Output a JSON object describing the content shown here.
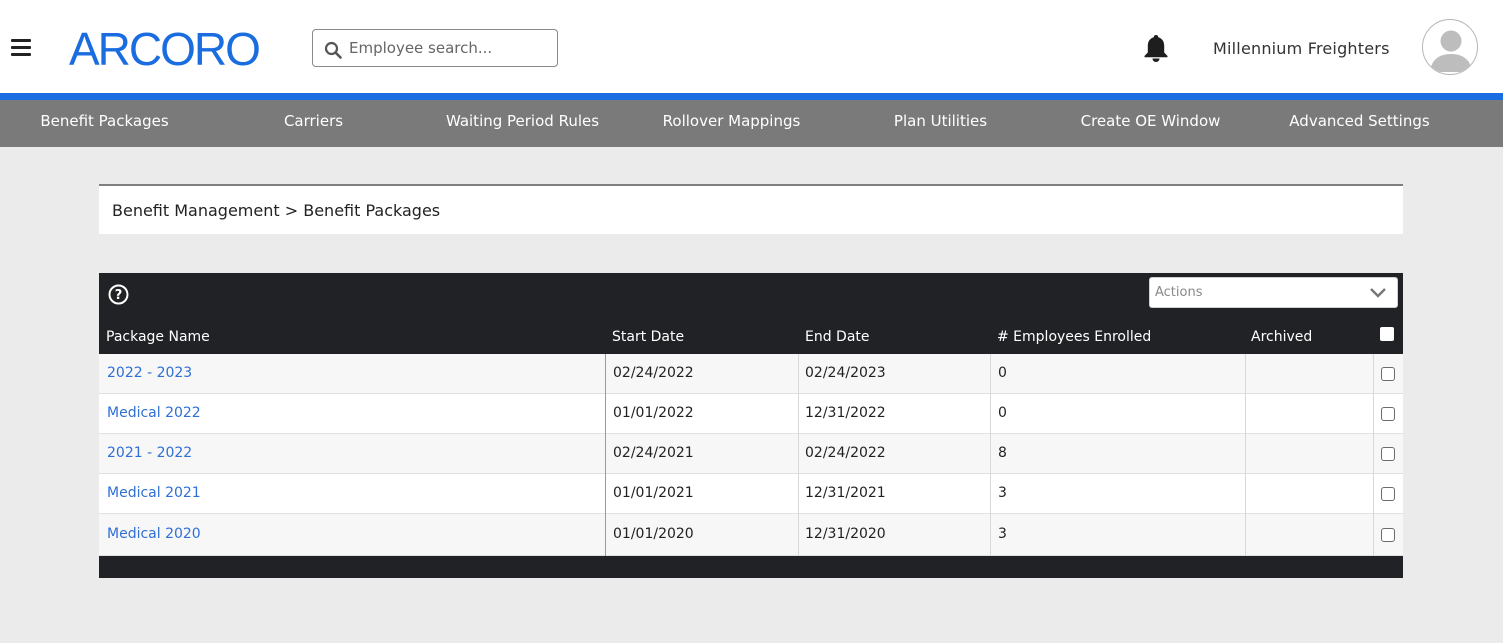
{
  "header": {
    "logo_text": "ARCORO",
    "search": {
      "placeholder": "Employee search...",
      "value": ""
    },
    "company_name": "Millennium Freighters"
  },
  "nav": {
    "items": [
      {
        "label": "Benefit Packages"
      },
      {
        "label": "Carriers"
      },
      {
        "label": "Waiting Period Rules"
      },
      {
        "label": "Rollover Mappings"
      },
      {
        "label": "Plan Utilities"
      },
      {
        "label": "Create OE Window"
      },
      {
        "label": "Advanced Settings"
      }
    ]
  },
  "breadcrumb": {
    "parent": "Benefit Management",
    "separator": ">",
    "current": "Benefit Packages"
  },
  "table": {
    "actions_placeholder": "Actions",
    "columns": {
      "package_name": "Package Name",
      "start_date": "Start Date",
      "end_date": "End Date",
      "employees_enrolled": "# Employees Enrolled",
      "archived": "Archived"
    },
    "rows": [
      {
        "package_name": "2022 - 2023",
        "start_date": "02/24/2022",
        "end_date": "02/24/2023",
        "employees_enrolled": "0",
        "archived": ""
      },
      {
        "package_name": "Medical 2022",
        "start_date": "01/01/2022",
        "end_date": "12/31/2022",
        "employees_enrolled": "0",
        "archived": ""
      },
      {
        "package_name": "2021 - 2022",
        "start_date": "02/24/2021",
        "end_date": "02/24/2022",
        "employees_enrolled": "8",
        "archived": ""
      },
      {
        "package_name": "Medical 2021",
        "start_date": "01/01/2021",
        "end_date": "12/31/2021",
        "employees_enrolled": "3",
        "archived": ""
      },
      {
        "package_name": "Medical 2020",
        "start_date": "01/01/2020",
        "end_date": "12/31/2020",
        "employees_enrolled": "3",
        "archived": ""
      }
    ]
  },
  "colors": {
    "brand_blue": "#1a6de0",
    "nav_gray": "#7a7a7a",
    "table_header": "#212226",
    "link_blue": "#2f6fd6",
    "page_bg": "#ebebeb"
  }
}
